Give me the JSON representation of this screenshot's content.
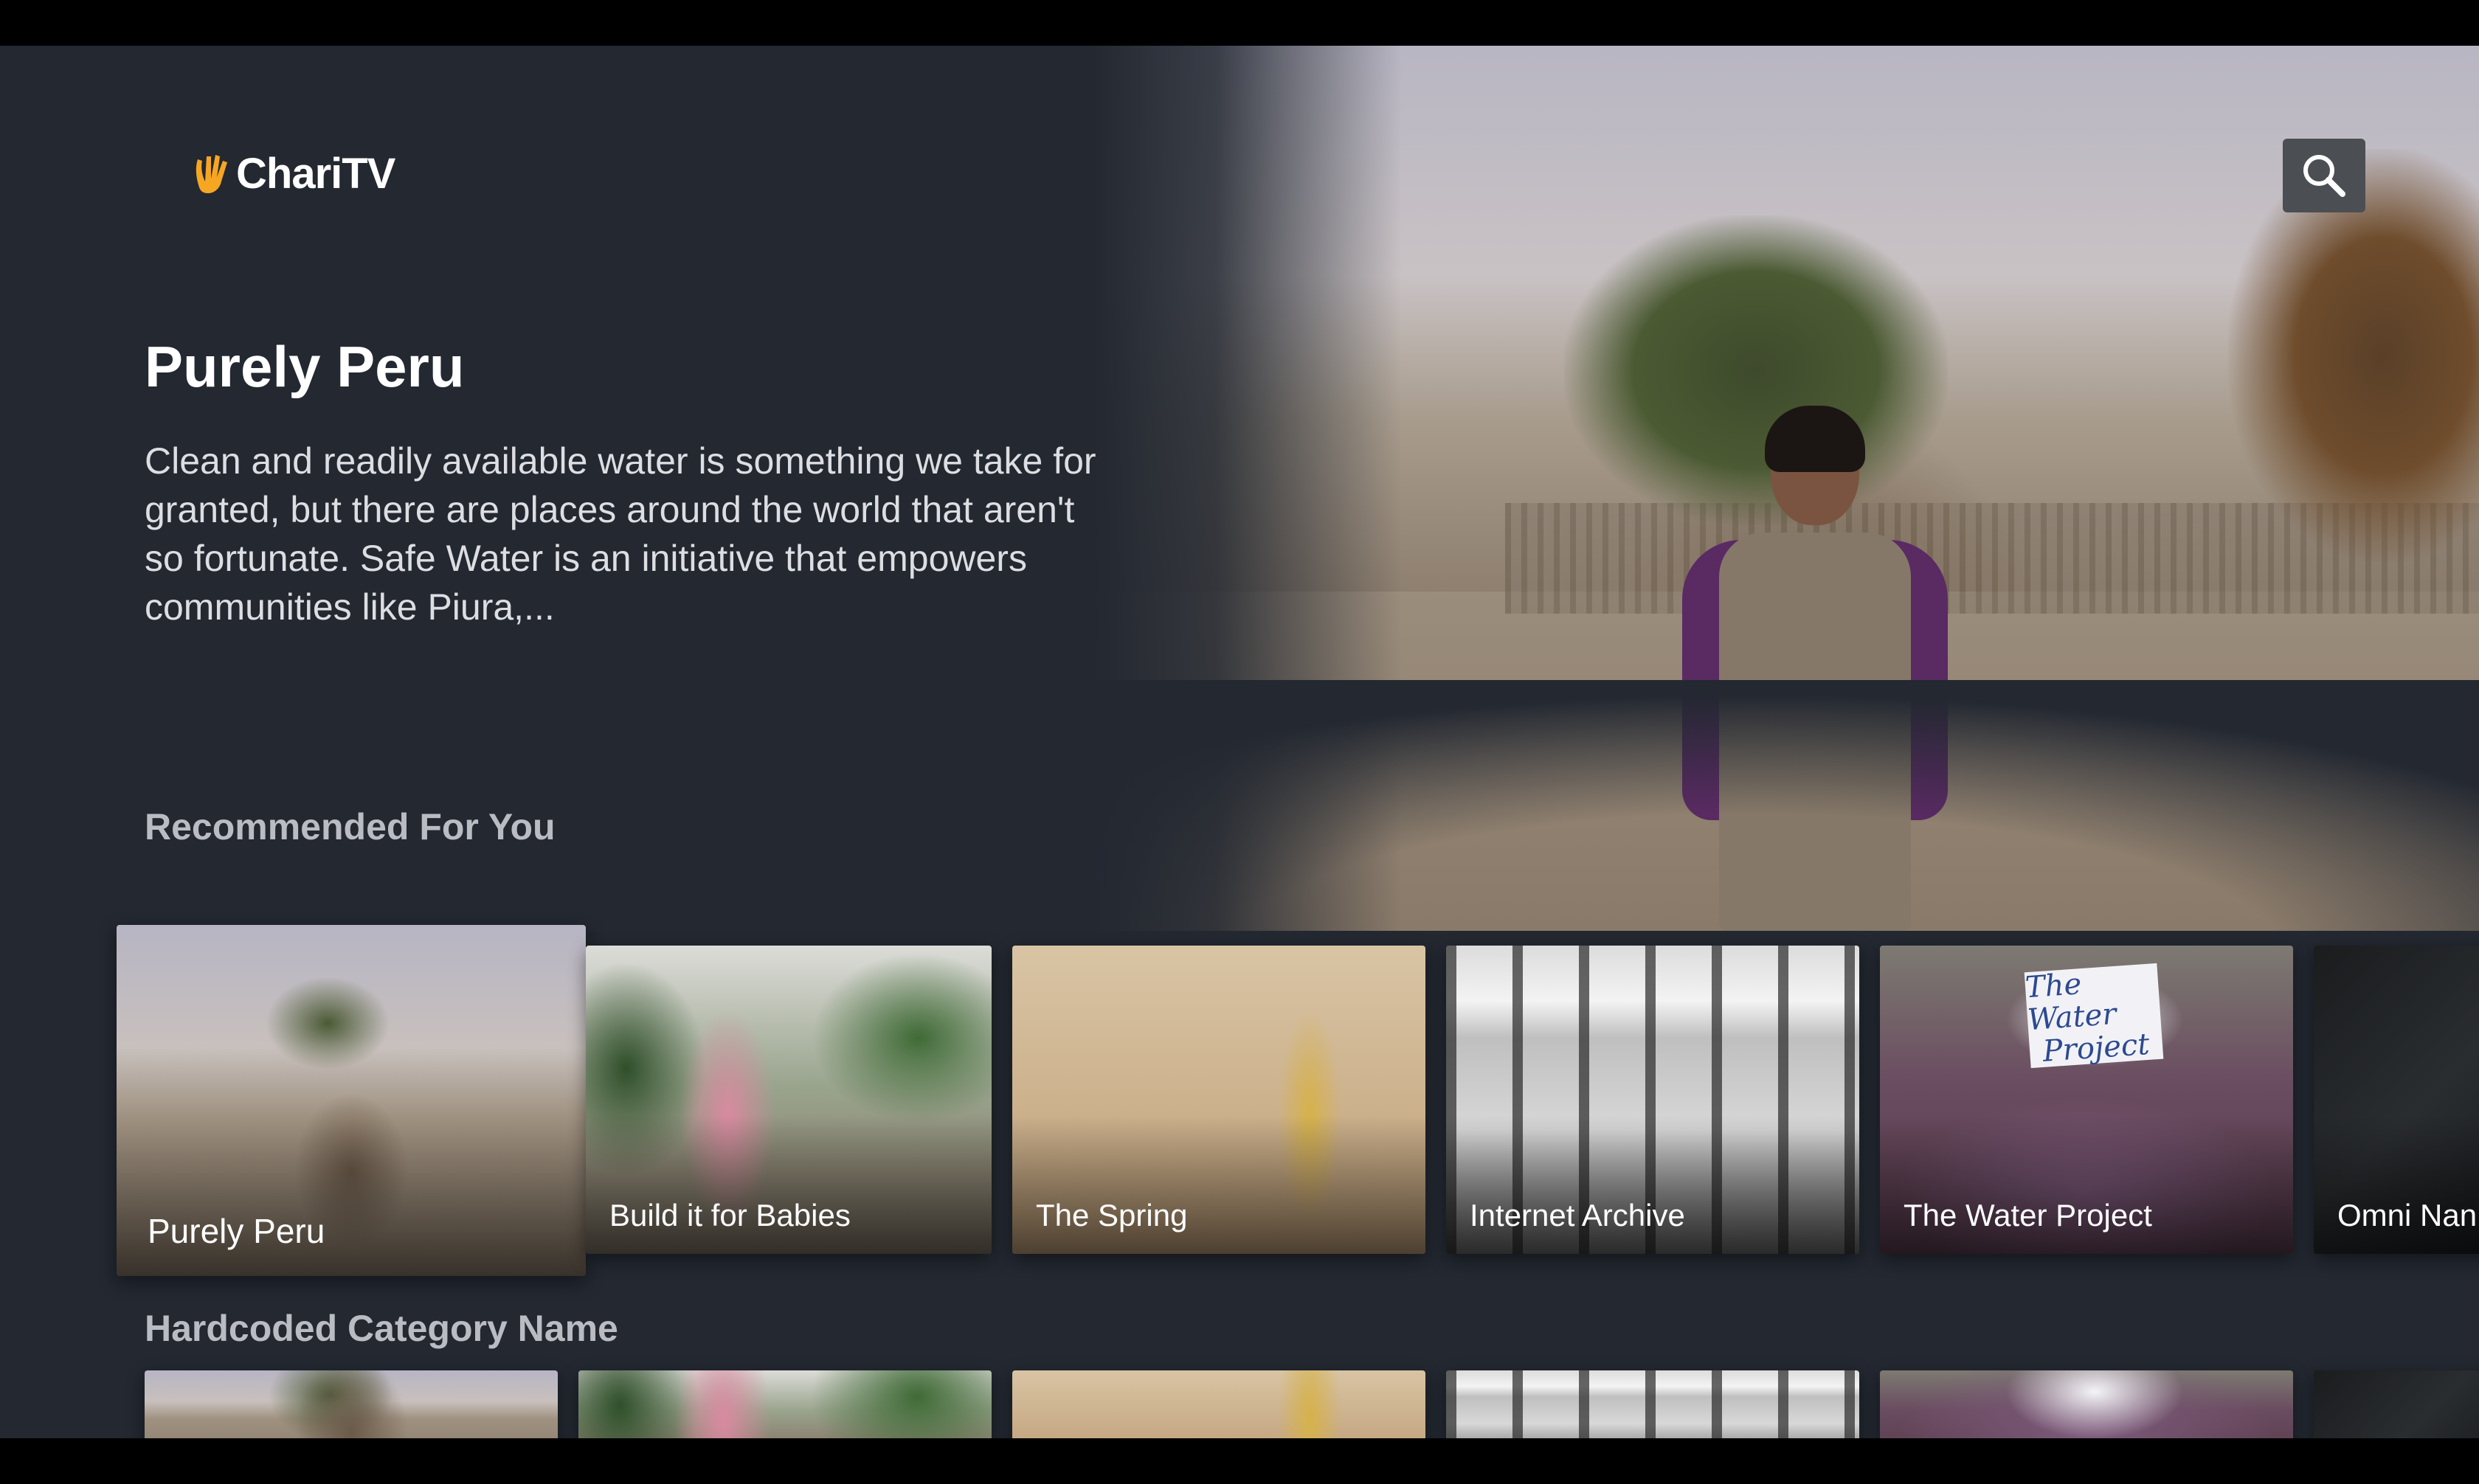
{
  "app": {
    "logo_text": "ChariTV",
    "brand_color": "#f5a623"
  },
  "header": {
    "search_icon": "search-icon"
  },
  "hero": {
    "title": "Purely Peru",
    "description": "Clean and readily available water is something we take for granted, but there are places around the world that aren't so fortunate. Safe Water is an initiative that empowers communities like Piura,..."
  },
  "rows": [
    {
      "title": "Recommended For You",
      "cards": [
        {
          "label": "Purely Peru",
          "focused": true
        },
        {
          "label": "Build it for Babies"
        },
        {
          "label": "The Spring"
        },
        {
          "label": "Internet Archive"
        },
        {
          "label": "The Water Project",
          "sign_line1": "The Water",
          "sign_line2": "Project"
        },
        {
          "label": "Omni Nan"
        }
      ]
    },
    {
      "title": "Hardcoded Category Name"
    }
  ]
}
